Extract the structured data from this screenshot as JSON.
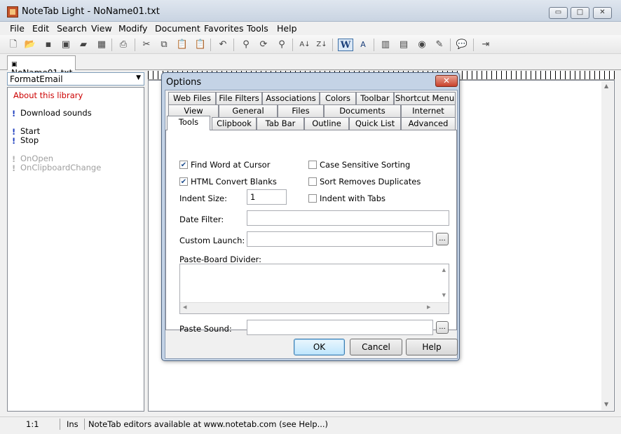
{
  "window": {
    "title": "NoteTab Light  -  NoName01.txt",
    "min": "▭",
    "max": "□",
    "close": "✕"
  },
  "menu": [
    "File",
    "Edit",
    "Search",
    "View",
    "Modify",
    "Document",
    "Favorites",
    "Tools",
    "Help"
  ],
  "doc_tab": "NoName01.txt",
  "library": {
    "selected": "FormatEmail",
    "items": [
      {
        "label": "About this library",
        "color": "#cc0000"
      },
      {
        "label": "Download sounds",
        "color": "#000000"
      },
      {
        "label": "Start",
        "color": "#000000"
      },
      {
        "label": "Stop",
        "color": "#000000"
      },
      {
        "label": "OnOpen",
        "color": "#a0a0a0"
      },
      {
        "label": "OnClipboardChange",
        "color": "#a0a0a0"
      }
    ]
  },
  "status": {
    "pos": "1:1",
    "mode": "Ins",
    "message": "NoteTab editors available at www.notetab.com (see Help...)"
  },
  "dialog": {
    "title": "Options",
    "tabs_row1": [
      "Web Files",
      "File Filters",
      "Associations",
      "Colors",
      "Toolbar",
      "Shortcut Menu"
    ],
    "tabs_row2": [
      "View",
      "General",
      "Files",
      "Documents",
      "Internet"
    ],
    "tabs_row3": [
      "Tools",
      "Clipbook",
      "Tab Bar",
      "Outline",
      "Quick List",
      "Advanced"
    ],
    "find_word": {
      "label": "Find Word at Cursor",
      "checked": true
    },
    "html_blanks": {
      "label": "HTML Convert Blanks",
      "checked": true
    },
    "indent_size": {
      "label": "Indent Size:",
      "value": "1"
    },
    "case_sort": {
      "label": "Case Sensitive Sorting",
      "checked": false
    },
    "sort_dups": {
      "label": "Sort Removes Duplicates",
      "checked": false
    },
    "indent_tabs": {
      "label": "Indent with Tabs",
      "checked": false
    },
    "date_filter": {
      "label": "Date Filter:",
      "value": ""
    },
    "custom_launch": {
      "label": "Custom Launch:",
      "value": ""
    },
    "pasteboard": {
      "label": "Paste-Board Divider:",
      "value": ""
    },
    "paste_sound": {
      "label": "Paste Sound:",
      "value": ""
    },
    "ellipsis": "...",
    "ok": "OK",
    "cancel": "Cancel",
    "help": "Help"
  }
}
